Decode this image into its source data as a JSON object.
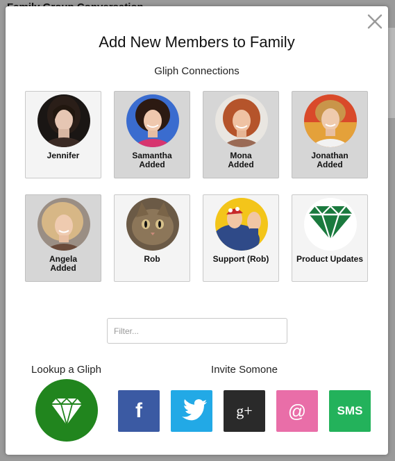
{
  "background": {
    "title": "Family Group Conversation"
  },
  "dialog": {
    "title": "Add New Members to Family",
    "connections_heading": "Gliph Connections",
    "close_icon": "close-x-icon"
  },
  "connections": [
    {
      "name": "Jennifer",
      "status": "",
      "added": false,
      "avatar": "photo-jennifer"
    },
    {
      "name": "Samantha",
      "status": "Added",
      "added": true,
      "avatar": "photo-samantha"
    },
    {
      "name": "Mona",
      "status": "Added",
      "added": true,
      "avatar": "photo-mona"
    },
    {
      "name": "Jonathan",
      "status": "Added",
      "added": true,
      "avatar": "photo-jonathan"
    },
    {
      "name": "Angela",
      "status": "Added",
      "added": true,
      "avatar": "photo-angela"
    },
    {
      "name": "Rob",
      "status": "",
      "added": false,
      "avatar": "photo-cat"
    },
    {
      "name": "Support (Rob)",
      "status": "",
      "added": false,
      "avatar": "illustration-rosie-riveter"
    },
    {
      "name": "Product Updates",
      "status": "",
      "added": false,
      "avatar": "gliph-diamond-logo"
    }
  ],
  "filter": {
    "placeholder": "Filter...",
    "value": ""
  },
  "lookup": {
    "label": "Lookup a Gliph",
    "icon": "diamond-icon",
    "color": "#21851e"
  },
  "invite": {
    "label": "Invite Somone",
    "buttons": [
      {
        "id": "facebook",
        "glyph": "f",
        "color": "#3b5aa3"
      },
      {
        "id": "twitter",
        "glyph": "bird",
        "color": "#22a9e6"
      },
      {
        "id": "google-plus",
        "glyph": "g+",
        "color": "#2a2a2a"
      },
      {
        "id": "email",
        "glyph": "@",
        "color": "#e96ea8"
      },
      {
        "id": "sms",
        "glyph": "SMS",
        "color": "#23b25b"
      }
    ]
  }
}
